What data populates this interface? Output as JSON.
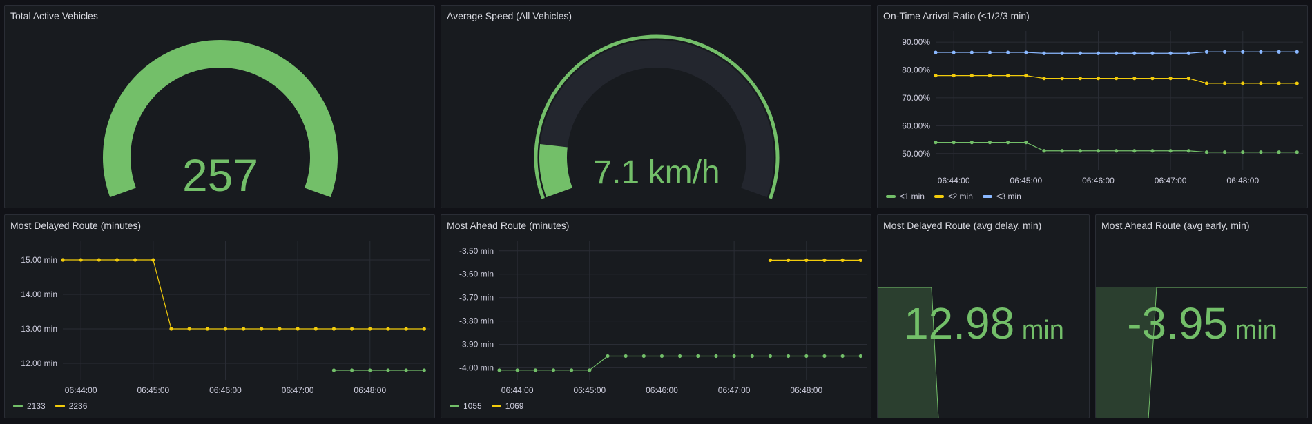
{
  "colors": {
    "green": "#73bf69",
    "yellow": "#f2cc0c",
    "blue": "#8ab8ff",
    "gauge_track": "#23262e",
    "grid": "#2a2d35",
    "panel_bg": "#181b1f"
  },
  "panels": {
    "total_active": {
      "title": "Total Active Vehicles",
      "value": "257",
      "fill_fraction": 1.0
    },
    "avg_speed": {
      "title": "Average Speed (All Vehicles)",
      "value": "7.1",
      "unit": "km/h",
      "fill_fraction": 0.12
    },
    "on_time": {
      "title": "On-Time Arrival Ratio (≤1/2/3 min)"
    },
    "delayed_route": {
      "title": "Most Delayed Route (minutes)"
    },
    "ahead_route": {
      "title": "Most Ahead Route (minutes)"
    },
    "delayed_stat": {
      "title": "Most Delayed Route (avg delay, min)",
      "value": "12.98",
      "unit": "min"
    },
    "ahead_stat": {
      "title": "Most Ahead Route (avg early, min)",
      "value": "-3.95",
      "unit": "min"
    }
  },
  "chart_data": [
    {
      "id": "on_time",
      "type": "line",
      "ylim": [
        45,
        92
      ],
      "yticks": [
        50,
        60,
        70,
        80,
        90
      ],
      "ytick_labels": [
        "50.00%",
        "60.00%",
        "70.00%",
        "80.00%",
        "90.00%"
      ],
      "xlim": [
        "06:43:45",
        "06:48:50"
      ],
      "xticks": [
        "06:44:00",
        "06:45:00",
        "06:46:00",
        "06:47:00",
        "06:48:00"
      ],
      "grid": true,
      "legend": "bottom-left",
      "series": [
        {
          "name": "≤1 min",
          "color": "#73bf69",
          "x": [
            "06:43:45",
            "06:44:00",
            "06:44:15",
            "06:44:30",
            "06:44:45",
            "06:45:00",
            "06:45:15",
            "06:45:30",
            "06:45:45",
            "06:46:00",
            "06:46:15",
            "06:46:30",
            "06:46:45",
            "06:47:00",
            "06:47:15",
            "06:47:30",
            "06:47:45",
            "06:48:00",
            "06:48:15",
            "06:48:30",
            "06:48:45"
          ],
          "y": [
            54,
            54,
            54,
            54,
            54,
            54,
            51,
            51,
            51,
            51,
            51,
            51,
            51,
            51,
            51,
            50.5,
            50.5,
            50.5,
            50.5,
            50.5,
            50.5
          ]
        },
        {
          "name": "≤2 min",
          "color": "#f2cc0c",
          "x": [
            "06:43:45",
            "06:44:00",
            "06:44:15",
            "06:44:30",
            "06:44:45",
            "06:45:00",
            "06:45:15",
            "06:45:30",
            "06:45:45",
            "06:46:00",
            "06:46:15",
            "06:46:30",
            "06:46:45",
            "06:47:00",
            "06:47:15",
            "06:47:30",
            "06:47:45",
            "06:48:00",
            "06:48:15",
            "06:48:30",
            "06:48:45"
          ],
          "y": [
            78,
            78,
            78,
            78,
            78,
            78,
            77,
            77,
            77,
            77,
            77,
            77,
            77,
            77,
            77,
            75.2,
            75.2,
            75.2,
            75.2,
            75.2,
            75.2
          ]
        },
        {
          "name": "≤3 min",
          "color": "#8ab8ff",
          "x": [
            "06:43:45",
            "06:44:00",
            "06:44:15",
            "06:44:30",
            "06:44:45",
            "06:45:00",
            "06:45:15",
            "06:45:30",
            "06:45:45",
            "06:46:00",
            "06:46:15",
            "06:46:30",
            "06:46:45",
            "06:47:00",
            "06:47:15",
            "06:47:30",
            "06:47:45",
            "06:48:00",
            "06:48:15",
            "06:48:30",
            "06:48:45"
          ],
          "y": [
            86.3,
            86.3,
            86.3,
            86.3,
            86.3,
            86.3,
            86,
            86,
            86,
            86,
            86,
            86,
            86,
            86,
            86,
            86.5,
            86.5,
            86.5,
            86.5,
            86.5,
            86.5
          ]
        }
      ]
    },
    {
      "id": "delayed_route",
      "type": "line",
      "ylim": [
        11.6,
        15.4
      ],
      "yticks": [
        12,
        13,
        14,
        15
      ],
      "ytick_labels": [
        "12.00 min",
        "13.00 min",
        "14.00 min",
        "15.00 min"
      ],
      "xlim": [
        "06:43:45",
        "06:48:50"
      ],
      "xticks": [
        "06:44:00",
        "06:45:00",
        "06:46:00",
        "06:47:00",
        "06:48:00"
      ],
      "grid": true,
      "legend": "bottom-left",
      "series": [
        {
          "name": "2133",
          "color": "#73bf69",
          "x": [
            "06:47:30",
            "06:47:45",
            "06:48:00",
            "06:48:15",
            "06:48:30",
            "06:48:45"
          ],
          "y": [
            11.8,
            11.8,
            11.8,
            11.8,
            11.8,
            11.8
          ]
        },
        {
          "name": "2236",
          "color": "#f2cc0c",
          "x": [
            "06:43:45",
            "06:44:00",
            "06:44:15",
            "06:44:30",
            "06:44:45",
            "06:45:00",
            "06:45:15",
            "06:45:30",
            "06:45:45",
            "06:46:00",
            "06:46:15",
            "06:46:30",
            "06:46:45",
            "06:47:00",
            "06:47:15",
            "06:47:30",
            "06:47:45",
            "06:48:00",
            "06:48:15",
            "06:48:30",
            "06:48:45"
          ],
          "y": [
            15,
            15,
            15,
            15,
            15,
            15,
            13,
            13,
            13,
            13,
            13,
            13,
            13,
            13,
            13,
            13,
            13,
            13,
            13,
            13,
            13
          ]
        }
      ]
    },
    {
      "id": "ahead_route",
      "type": "line",
      "ylim": [
        -4.04,
        -3.48
      ],
      "yticks": [
        -4.0,
        -3.9,
        -3.8,
        -3.7,
        -3.6,
        -3.5
      ],
      "ytick_labels": [
        "-4.00 min",
        "-3.90 min",
        "-3.80 min",
        "-3.70 min",
        "-3.60 min",
        "-3.50 min"
      ],
      "xlim": [
        "06:43:45",
        "06:48:50"
      ],
      "xticks": [
        "06:44:00",
        "06:45:00",
        "06:46:00",
        "06:47:00",
        "06:48:00"
      ],
      "grid": true,
      "legend": "bottom-left",
      "series": [
        {
          "name": "1055",
          "color": "#73bf69",
          "x": [
            "06:43:45",
            "06:44:00",
            "06:44:15",
            "06:44:30",
            "06:44:45",
            "06:45:00",
            "06:45:15",
            "06:45:30",
            "06:45:45",
            "06:46:00",
            "06:46:15",
            "06:46:30",
            "06:46:45",
            "06:47:00",
            "06:47:15",
            "06:47:30",
            "06:47:45",
            "06:48:00",
            "06:48:15",
            "06:48:30",
            "06:48:45"
          ],
          "y": [
            -4.01,
            -4.01,
            -4.01,
            -4.01,
            -4.01,
            -4.01,
            -3.95,
            -3.95,
            -3.95,
            -3.95,
            -3.95,
            -3.95,
            -3.95,
            -3.95,
            -3.95,
            -3.95,
            -3.95,
            -3.95,
            -3.95,
            -3.95,
            -3.95
          ]
        },
        {
          "name": "1069",
          "color": "#f2cc0c",
          "x": [
            "06:47:30",
            "06:47:45",
            "06:48:00",
            "06:48:15",
            "06:48:30",
            "06:48:45"
          ],
          "y": [
            -3.54,
            -3.54,
            -3.54,
            -3.54,
            -3.54,
            -3.54
          ]
        }
      ]
    }
  ]
}
